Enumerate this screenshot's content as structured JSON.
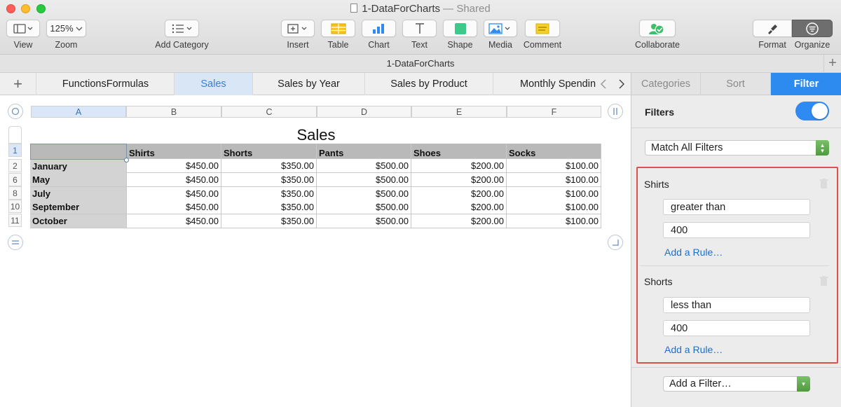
{
  "window": {
    "title": "1-DataForCharts",
    "shared_suffix": "— Shared",
    "file_name": "1-DataForCharts"
  },
  "toolbar": {
    "view_label": "View",
    "zoom_value": "125%",
    "zoom_label": "Zoom",
    "add_category_label": "Add Category",
    "insert_label": "Insert",
    "table_label": "Table",
    "chart_label": "Chart",
    "text_label": "Text",
    "shape_label": "Shape",
    "media_label": "Media",
    "comment_label": "Comment",
    "collaborate_label": "Collaborate",
    "format_label": "Format",
    "organize_label": "Organize"
  },
  "sheet_tabs": [
    {
      "label": "FunctionsFormulas",
      "active": false
    },
    {
      "label": "Sales",
      "active": true
    },
    {
      "label": "Sales by Year",
      "active": false
    },
    {
      "label": "Sales by Product",
      "active": false
    },
    {
      "label": "Monthly Spending",
      "active": false
    }
  ],
  "table": {
    "title": "Sales",
    "column_letters": [
      "A",
      "B",
      "C",
      "D",
      "E",
      "F"
    ],
    "row_numbers": [
      "1",
      "2",
      "6",
      "8",
      "10",
      "11"
    ],
    "headers": [
      "",
      "Shirts",
      "Shorts",
      "Pants",
      "Shoes",
      "Socks"
    ],
    "rows": [
      {
        "label": "January",
        "values": [
          "$450.00",
          "$350.00",
          "$500.00",
          "$200.00",
          "$100.00"
        ]
      },
      {
        "label": "May",
        "values": [
          "$450.00",
          "$350.00",
          "$500.00",
          "$200.00",
          "$100.00"
        ]
      },
      {
        "label": "July",
        "values": [
          "$450.00",
          "$350.00",
          "$500.00",
          "$200.00",
          "$100.00"
        ]
      },
      {
        "label": "September",
        "values": [
          "$450.00",
          "$350.00",
          "$500.00",
          "$200.00",
          "$100.00"
        ]
      },
      {
        "label": "October",
        "values": [
          "$450.00",
          "$350.00",
          "$500.00",
          "$200.00",
          "$100.00"
        ]
      }
    ]
  },
  "inspector": {
    "tabs": [
      "Categories",
      "Sort",
      "Filter"
    ],
    "active_tab": "Filter",
    "filters_heading": "Filters",
    "filters_enabled": true,
    "match_mode": "Match All Filters",
    "filters": [
      {
        "column": "Shirts",
        "condition": "greater than",
        "value": "400",
        "add_rule": "Add a Rule…"
      },
      {
        "column": "Shorts",
        "condition": "less than",
        "value": "400",
        "add_rule": "Add a Rule…"
      }
    ],
    "add_filter": "Add a Filter…",
    "accent_color": "#2d8bf0",
    "highlight_color": "#e0504a"
  }
}
